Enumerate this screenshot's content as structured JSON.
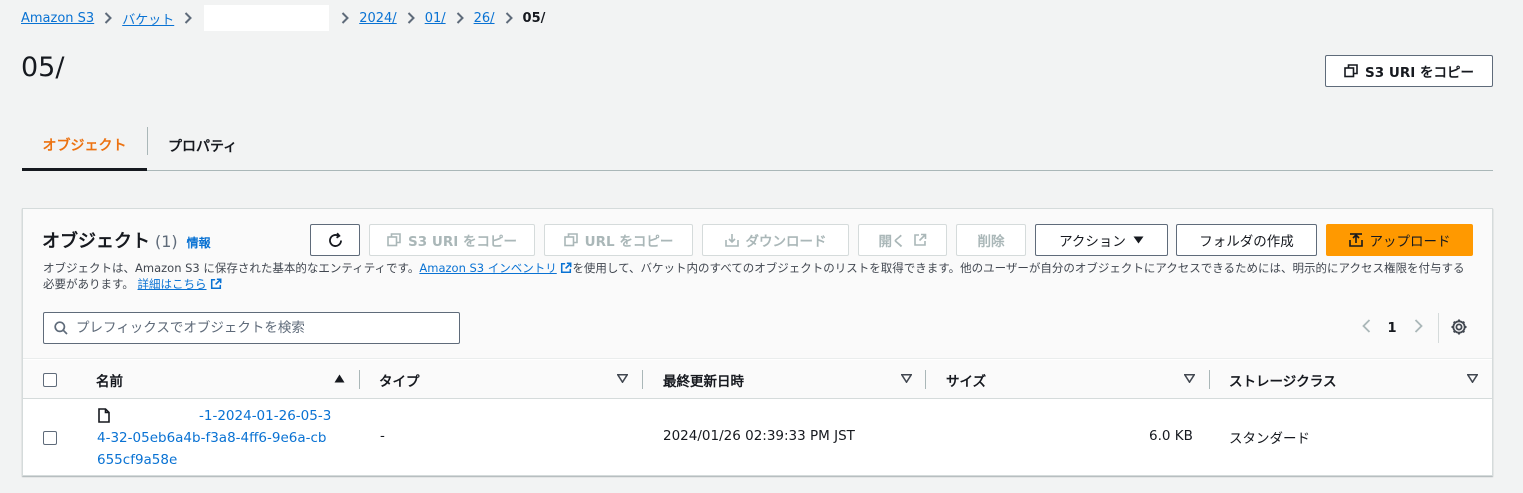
{
  "breadcrumb": {
    "items": [
      "Amazon S3",
      "バケット",
      "2024/",
      "01/",
      "26/"
    ],
    "current": "05/"
  },
  "page": {
    "title": "05/",
    "copy_uri_label": "S3 URI をコピー"
  },
  "tabs": [
    {
      "label": "オブジェクト",
      "active": true
    },
    {
      "label": "プロパティ",
      "active": false
    }
  ],
  "objects_panel": {
    "title": "オブジェクト",
    "count": "(1)",
    "info_label": "情報",
    "toolbar": {
      "refresh_icon": "refresh-icon",
      "copy_s3_uri": "S3 URI をコピー",
      "copy_url": "URL をコピー",
      "download": "ダウンロード",
      "open": "開く",
      "delete": "削除",
      "actions": "アクション",
      "create_folder": "フォルダの作成",
      "upload": "アップロード"
    },
    "description": {
      "part1": "オブジェクトは、Amazon S3 に保存された基本的なエンティティです。",
      "inventory_link": "Amazon S3 インベントリ",
      "part2": "を使用して、バケット内のすべてのオブジェクトのリストを取得できます。他のユーザーが自分のオブジェクトにアクセスできるためには、明示的にアクセス権限を付与する必要があります。",
      "details_link": "詳細はこちら"
    },
    "search": {
      "placeholder": "プレフィックスでオブジェクトを検索",
      "value": ""
    },
    "pagination": {
      "current_page": "1"
    },
    "columns": [
      "名前",
      "タイプ",
      "最終更新日時",
      "サイズ",
      "ストレージクラス"
    ],
    "rows": [
      {
        "name": "-1-2024-01-26-05-34-32-05eb6a4b-f3a8-4ff6-9e6a-cb655cf9a58e",
        "type": "-",
        "last_modified": "2024/01/26 02:39:33 PM JST",
        "size": "6.0 KB",
        "storage_class": "スタンダード"
      }
    ]
  },
  "colors": {
    "link": "#0972d3",
    "active_tab": "#ec7211",
    "primary_button": "#ff9900",
    "background": "#f2f3f3"
  }
}
